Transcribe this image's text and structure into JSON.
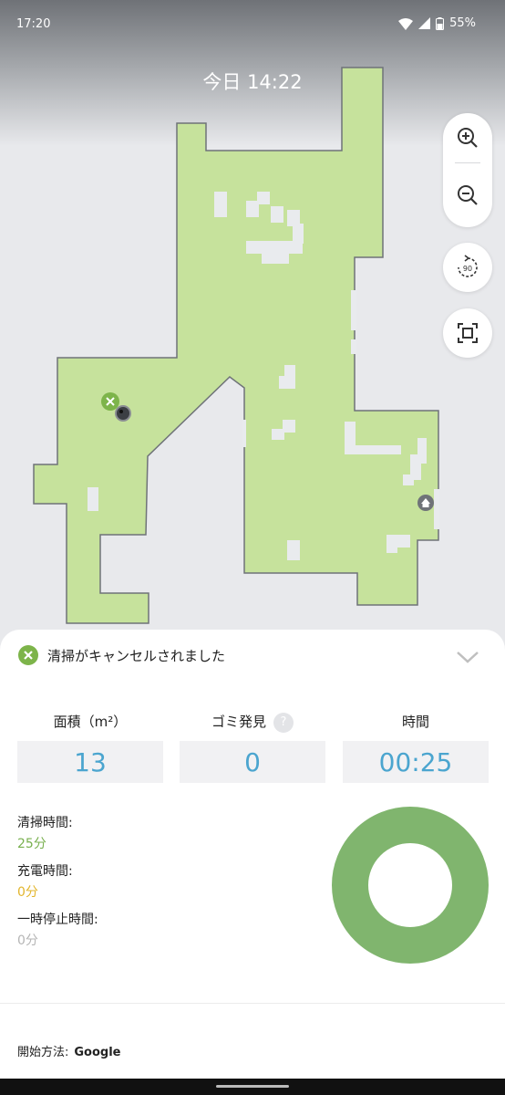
{
  "status_bar": {
    "time": "17:20",
    "battery": "55%"
  },
  "map": {
    "date_label": "今日 14:22",
    "floor_color": "#c6e29c",
    "wall_color": "#6f7378"
  },
  "map_controls": {
    "zoom_in_icon": "zoom-in-icon",
    "zoom_out_icon": "zoom-out-icon",
    "rotate_label": "90",
    "fit_icon": "fit-screen-icon"
  },
  "panel": {
    "status_text": "清掃がキャンセルされました",
    "metrics": [
      {
        "label": "面積（m²）",
        "value": "13"
      },
      {
        "label": "ゴミ発見",
        "value": "0",
        "help": "?"
      },
      {
        "label": "時間",
        "value": "00:25"
      }
    ],
    "stats": [
      {
        "label": "清掃時間:",
        "value": "25分",
        "color": "#79b04f"
      },
      {
        "label": "充電時間:",
        "value": "0分",
        "color": "#e2b52c"
      },
      {
        "label": "一時停止時間:",
        "value": "0分",
        "color": "#b5b5b5"
      }
    ],
    "donut_color": "#80b56e",
    "start_method_label": "開始方法:",
    "start_method_value": "Google"
  }
}
